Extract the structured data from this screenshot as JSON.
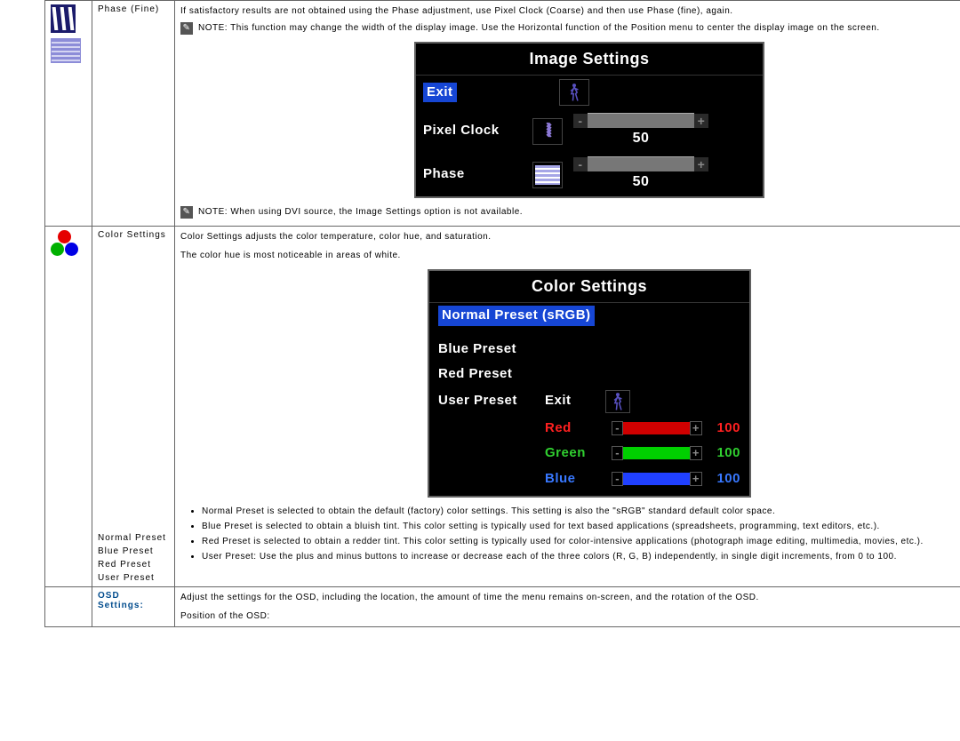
{
  "row1": {
    "label": "Phase (Fine)",
    "text1": "If satisfactory results are not obtained using the Phase adjustment, use Pixel Clock (Coarse) and then use Phase (fine), again.",
    "note1": "NOTE: This function may change the width of the display image.  Use the Horizontal function of the Position menu to center the display image on the screen.",
    "note2": "NOTE: When using  DVI source, the Image Settings option is not available."
  },
  "imageSettings": {
    "title": "Image Settings",
    "exit": "Exit",
    "pixelClock": "Pixel Clock",
    "pixelClockValue": "50",
    "phase": "Phase",
    "phaseValue": "50"
  },
  "row2": {
    "label": "Color Settings",
    "text1": "Color Settings adjusts the color temperature, color hue, and saturation.",
    "text2": "The color hue is most noticeable in areas of white.",
    "sublabels": {
      "normal": "Normal Preset",
      "blue": "Blue Preset",
      "red": "Red Preset",
      "user": "User Preset"
    },
    "bullets": [
      "Normal Preset is selected to obtain the default (factory) color settings. This setting is also the \"sRGB\" standard default color space.",
      "Blue Preset is selected to obtain a bluish tint. This color setting is typically used for text based applications (spreadsheets, programming, text editors, etc.).",
      "Red Preset is selected to obtain a redder tint. This color setting is typically used for color-intensive applications (photograph image editing, multimedia, movies, etc.).",
      "User Preset: Use the plus and minus buttons to increase or decrease each of the three colors (R, G, B) independently, in single digit increments, from 0 to 100."
    ]
  },
  "colorSettings": {
    "title": "Color Settings",
    "normalPreset": "Normal Preset (sRGB)",
    "bluePreset": "Blue Preset",
    "redPreset": "Red Preset",
    "userPreset": "User Preset",
    "exit": "Exit",
    "red": "Red",
    "redValue": "100",
    "green": "Green",
    "greenValue": "100",
    "blue": "Blue",
    "blueValue": "100"
  },
  "row3": {
    "label": "OSD Settings:",
    "text1": "Adjust the settings for the OSD, including the location, the amount of time the menu remains on-screen, and the rotation of the OSD.",
    "text2": "Position of the OSD:"
  }
}
